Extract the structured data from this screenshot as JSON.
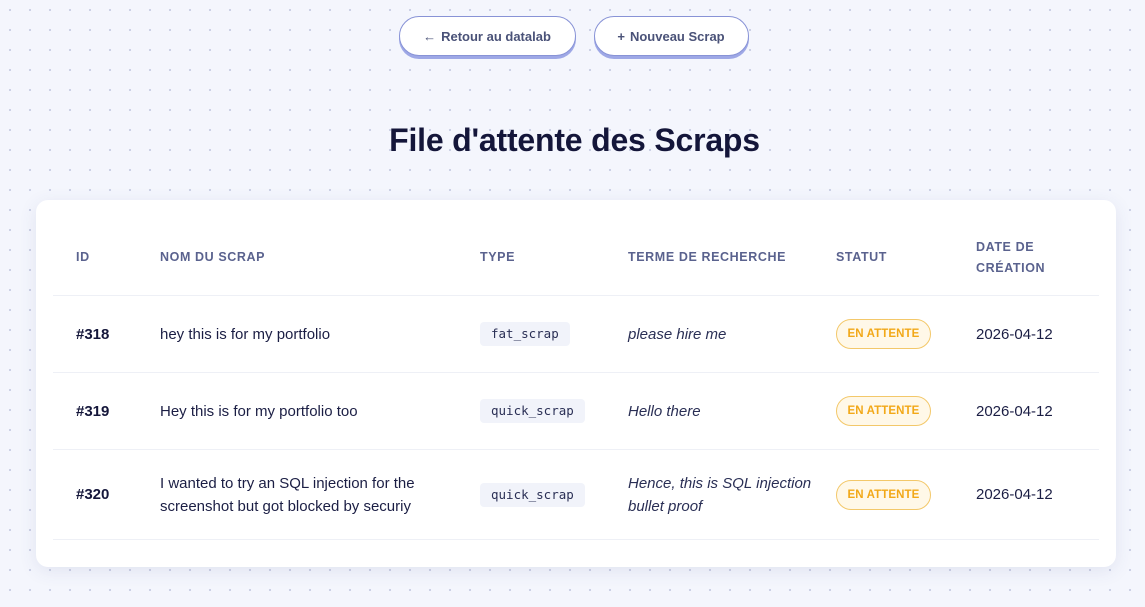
{
  "nav": {
    "back": {
      "glyph": "←",
      "label": "Retour au datalab"
    },
    "new": {
      "glyph": "+",
      "label": "Nouveau Scrap"
    }
  },
  "page": {
    "title": "File d'attente des Scraps"
  },
  "table": {
    "headers": {
      "id": "ID",
      "name": "Nom du scrap",
      "type": "Type",
      "term": "Terme de recherche",
      "status": "Statut",
      "date": "Date de création"
    },
    "rows": [
      {
        "id": "#318",
        "name": "hey this is for my portfolio",
        "type": "fat_scrap",
        "term": "please hire me",
        "status": "En attente",
        "date": "2026-04-12"
      },
      {
        "id": "#319",
        "name": "Hey this is for my portfolio too",
        "type": "quick_scrap",
        "term": "Hello there",
        "status": "En attente",
        "date": "2026-04-12"
      },
      {
        "id": "#320",
        "name": "I wanted to try an SQL injection for the screenshot but got blocked by securiy",
        "type": "quick_scrap",
        "term": "Hence, this is SQL injection bullet proof",
        "status": "En attente",
        "date": "2026-04-12"
      }
    ]
  },
  "colors": {
    "background": "#f4f6fd",
    "title": "#14163a",
    "button_border": "#8893d6",
    "status_text": "#f2a818",
    "status_bg": "#fff8e8",
    "status_border": "#f3c86a"
  }
}
